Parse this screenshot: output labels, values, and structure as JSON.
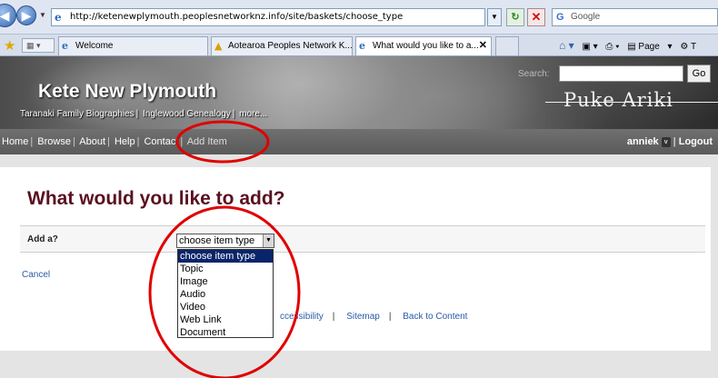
{
  "browser": {
    "url": "http://ketenewplymouth.peoplesnetworknz.info/site/baskets/choose_type",
    "search_placeholder": "Google",
    "tabs": [
      {
        "label": "Welcome",
        "active": false
      },
      {
        "label": "Aotearoa Peoples Network K...",
        "active": false
      },
      {
        "label": "What would you like to a...",
        "active": true
      }
    ],
    "tab_close": "✕",
    "command_bar": {
      "page_label": "Page",
      "tools_label": "T"
    }
  },
  "site": {
    "title": "Kete New Plymouth",
    "sublinks": [
      "Taranaki Family Biographies",
      "Inglewood Genealogy",
      "more..."
    ],
    "search_label": "Search:",
    "go_label": "Go",
    "logo_text": "Puke Ariki",
    "nav": [
      "Home",
      "Browse",
      "About",
      "Help",
      "Contact"
    ],
    "nav_current": "Add Item",
    "user": "anniek",
    "user_badge": "v",
    "logout": "Logout"
  },
  "form": {
    "heading": "What would you like to add?",
    "label": "Add a?",
    "select_value": "choose item type",
    "options": [
      "choose item type",
      "Topic",
      "Image",
      "Audio",
      "Video",
      "Web Link",
      "Document"
    ],
    "selected_index": 0,
    "cancel": "Cancel"
  },
  "footer": {
    "links": [
      "ccessibility",
      "Sitemap",
      "Back to Content"
    ]
  },
  "colors": {
    "heading": "#5a1020",
    "link": "#2a5aa8",
    "annotation": "#e00000",
    "selection": "#0a246a"
  }
}
